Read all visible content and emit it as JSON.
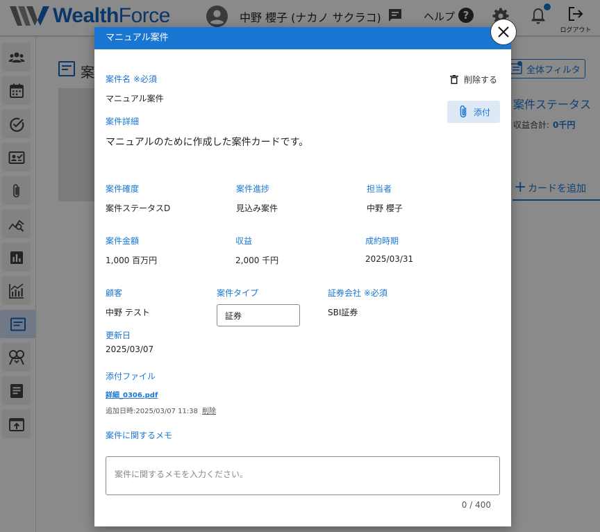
{
  "app": {
    "brand_wealth": "Wealth",
    "brand_force": "Force",
    "user_name": "中野 櫻子 (ナカノ サクラコ)",
    "help_label": "ヘルプ",
    "logout_label": "ログアウト",
    "accent_color": "#1976d2"
  },
  "background": {
    "page_title": "案",
    "filter_label": "全体フィルタ",
    "status_title": "案件ステータス",
    "revenue_label": "収益合計:",
    "revenue_value": "0千円",
    "add_card_label": "カードを追加"
  },
  "sidebar": {
    "items": [
      {
        "icon": "people-icon"
      },
      {
        "icon": "calendar-icon"
      },
      {
        "icon": "check-circle-icon"
      },
      {
        "icon": "contact-card-icon"
      },
      {
        "icon": "paperclip-icon"
      },
      {
        "icon": "chart-search-icon"
      },
      {
        "icon": "bar-chart-icon"
      },
      {
        "icon": "analytics-icon"
      },
      {
        "icon": "deal-card-icon",
        "active": true
      },
      {
        "icon": "handshake-icon"
      },
      {
        "icon": "document-icon"
      },
      {
        "icon": "export-icon"
      }
    ]
  },
  "modal": {
    "title": "マニュアル案件",
    "name_label": "案件名 ※必須",
    "name_value": "マニュアル案件",
    "delete_label": "削除する",
    "attach_label": "添付",
    "detail_label": "案件詳細",
    "detail_value": "マニュアルのために作成した案件カードです。",
    "certainty_label": "案件確度",
    "certainty_value": "案件ステータスD",
    "progress_label": "案件進捗",
    "progress_value": "見込み案件",
    "owner_label": "担当者",
    "owner_value": "中野 櫻子",
    "amount_label": "案件金額",
    "amount_value": "1,000 百万円",
    "revenue_label": "収益",
    "revenue_value": "2,000 千円",
    "close_label": "成約時期",
    "close_value": "2025/03/31",
    "customer_label": "顧客",
    "customer_value": "中野 テスト",
    "type_label": "案件タイプ",
    "type_value": "証券",
    "broker_label": "証券会社 ※必須",
    "broker_value": "SBI証券",
    "updated_label": "更新日",
    "updated_value": "2025/03/07",
    "files_label": "添付ファイル",
    "file_name": "詳細_0306.pdf",
    "file_added": "追加日時:2025/03/07 11:38",
    "file_delete": "削除",
    "memo_label": "案件に関するメモ",
    "memo_placeholder": "案件に関するメモを入力ください。",
    "memo_count": "0 / 400"
  }
}
